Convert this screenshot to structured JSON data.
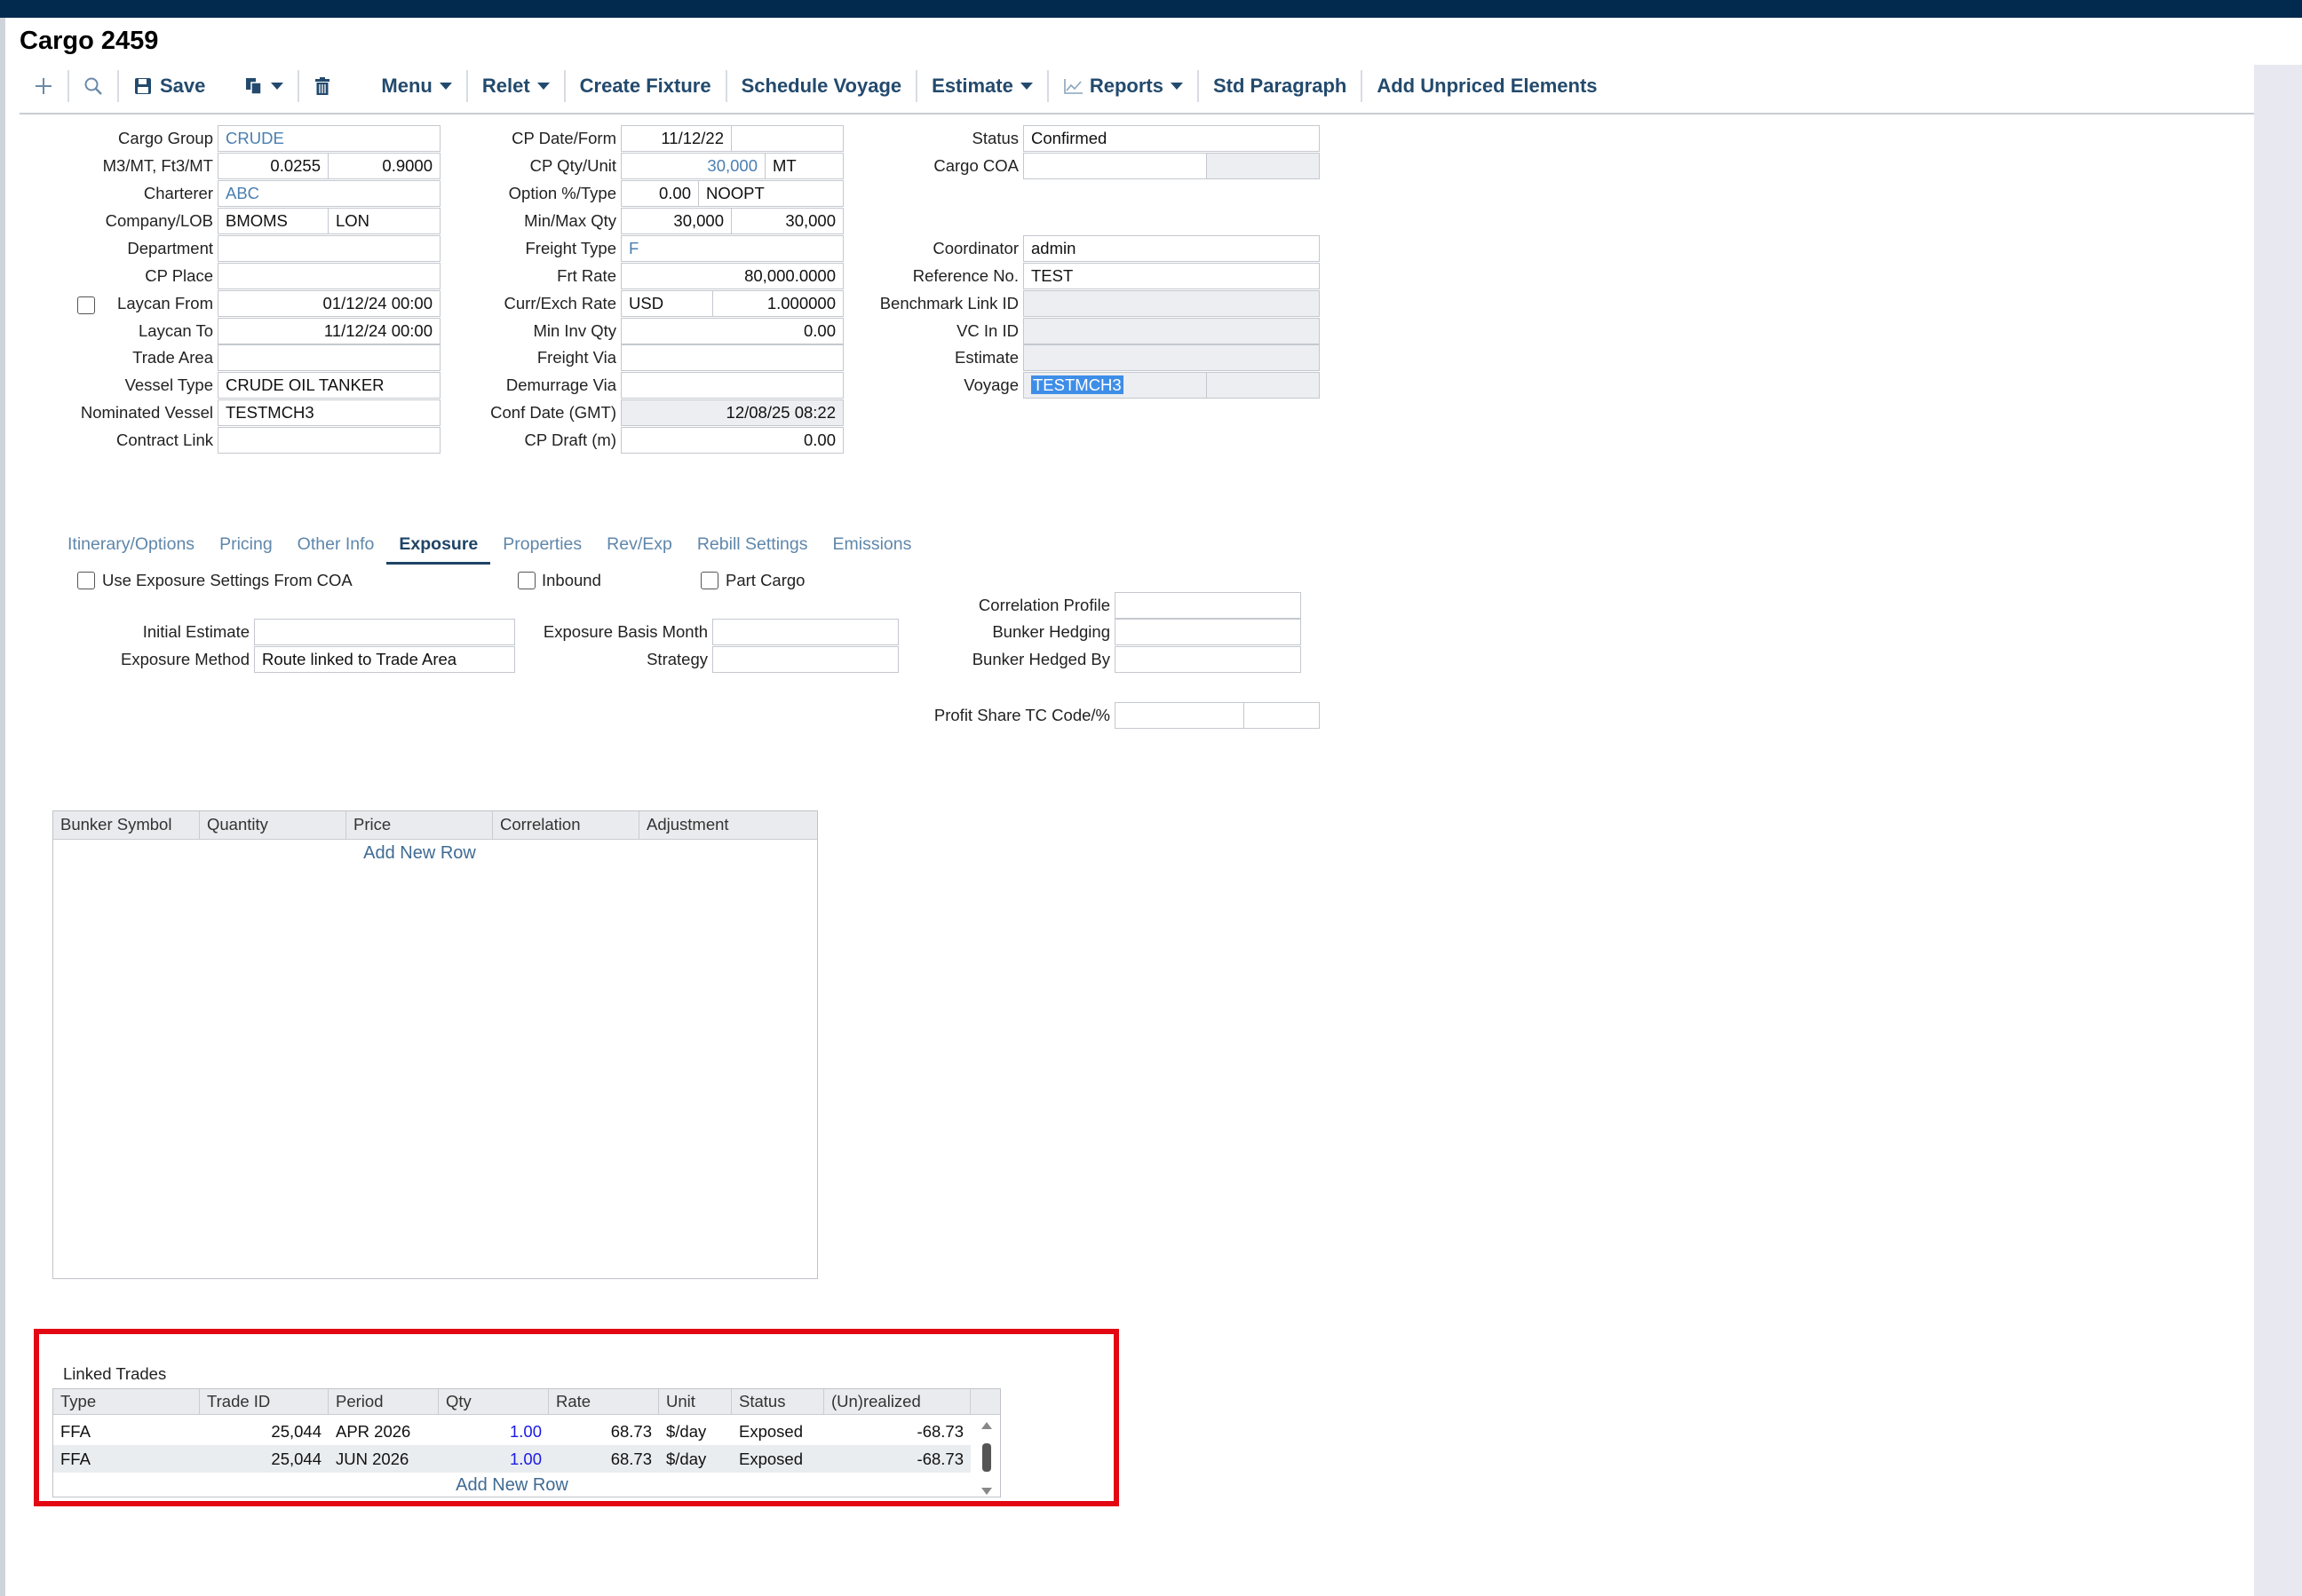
{
  "window": {
    "title": "Cargo 2459"
  },
  "toolbar": {
    "save_label": "Save",
    "menu_label": "Menu",
    "relet_label": "Relet",
    "create_fixture_label": "Create Fixture",
    "schedule_voyage_label": "Schedule Voyage",
    "estimate_label": "Estimate",
    "reports_label": "Reports",
    "std_paragraph_label": "Std Paragraph",
    "add_unpriced_label": "Add Unpriced Elements"
  },
  "form": {
    "cargo_group": {
      "label": "Cargo Group",
      "value": "CRUDE"
    },
    "m3mt": {
      "label": "M3/MT, Ft3/MT",
      "value1": "0.0255",
      "value2": "0.9000"
    },
    "charterer": {
      "label": "Charterer",
      "value": "ABC"
    },
    "company_lob": {
      "label": "Company/LOB",
      "value1": "BMOMS",
      "value2": "LON"
    },
    "department": {
      "label": "Department",
      "value": ""
    },
    "cp_place": {
      "label": "CP Place",
      "value": ""
    },
    "laycan_from": {
      "label": "Laycan From",
      "value": "01/12/24 00:00"
    },
    "laycan_to": {
      "label": "Laycan To",
      "value": "11/12/24 00:00"
    },
    "trade_area": {
      "label": "Trade Area",
      "value": ""
    },
    "vessel_type": {
      "label": "Vessel Type",
      "value": "CRUDE OIL TANKER"
    },
    "nominated_vessel": {
      "label": "Nominated Vessel",
      "value": "TESTMCH3"
    },
    "contract_link": {
      "label": "Contract Link",
      "value": ""
    },
    "cp_date_form": {
      "label": "CP Date/Form",
      "value1": "11/12/22",
      "value2": ""
    },
    "cp_qty_unit": {
      "label": "CP Qty/Unit",
      "value1": "30,000",
      "value2": "MT"
    },
    "option_type": {
      "label": "Option %/Type",
      "value1": "0.00",
      "value2": "NOOPT"
    },
    "min_max_qty": {
      "label": "Min/Max Qty",
      "value1": "30,000",
      "value2": "30,000"
    },
    "freight_type": {
      "label": "Freight Type",
      "value": "F"
    },
    "frt_rate": {
      "label": "Frt Rate",
      "value": "80,000.0000"
    },
    "curr_exch_rate": {
      "label": "Curr/Exch Rate",
      "value1": "USD",
      "value2": "1.000000"
    },
    "min_inv_qty": {
      "label": "Min Inv Qty",
      "value": "0.00"
    },
    "freight_via": {
      "label": "Freight Via",
      "value": ""
    },
    "demurrage_via": {
      "label": "Demurrage Via",
      "value": ""
    },
    "conf_date": {
      "label": "Conf Date (GMT)",
      "value": "12/08/25 08:22"
    },
    "cp_draft": {
      "label": "CP Draft (m)",
      "value": "0.00"
    },
    "status": {
      "label": "Status",
      "value": "Confirmed"
    },
    "cargo_coa": {
      "label": "Cargo COA",
      "value": ""
    },
    "coordinator": {
      "label": "Coordinator",
      "value": "admin"
    },
    "reference_no": {
      "label": "Reference No.",
      "value": "TEST"
    },
    "benchmark_link_id": {
      "label": "Benchmark Link ID",
      "value": ""
    },
    "vc_in_id": {
      "label": "VC In ID",
      "value": ""
    },
    "estimate": {
      "label": "Estimate",
      "value": ""
    },
    "voyage": {
      "label": "Voyage",
      "value": "TESTMCH3"
    }
  },
  "tabs": [
    {
      "label": "Itinerary/Options"
    },
    {
      "label": "Pricing"
    },
    {
      "label": "Other Info"
    },
    {
      "label": "Exposure"
    },
    {
      "label": "Properties"
    },
    {
      "label": "Rev/Exp"
    },
    {
      "label": "Rebill Settings"
    },
    {
      "label": "Emissions"
    }
  ],
  "exposure": {
    "use_coa_label": "Use Exposure Settings From COA",
    "inbound_label": "Inbound",
    "part_cargo_label": "Part Cargo",
    "correlation_profile": {
      "label": "Correlation Profile",
      "value": ""
    },
    "initial_estimate": {
      "label": "Initial Estimate",
      "value": ""
    },
    "exposure_basis_month": {
      "label": "Exposure Basis Month",
      "value": ""
    },
    "bunker_hedging": {
      "label": "Bunker Hedging",
      "value": ""
    },
    "exposure_method": {
      "label": "Exposure Method",
      "value": "Route linked to Trade Area"
    },
    "strategy": {
      "label": "Strategy",
      "value": ""
    },
    "bunker_hedged_by": {
      "label": "Bunker Hedged By",
      "value": ""
    },
    "profit_share": {
      "label": "Profit Share TC Code/%",
      "value1": "",
      "value2": ""
    }
  },
  "bunker_grid": {
    "columns": [
      "Bunker Symbol",
      "Quantity",
      "Price",
      "Correlation",
      "Adjustment"
    ],
    "add_row_label": "Add New Row"
  },
  "linked_trades": {
    "title": "Linked Trades",
    "columns": [
      "Type",
      "Trade ID",
      "Period",
      "Qty",
      "Rate",
      "Unit",
      "Status",
      "(Un)realized"
    ],
    "rows": [
      [
        "FFA",
        "25,044",
        "APR 2026",
        "1.00",
        "68.73",
        "$/day",
        "Exposed",
        "-68.73"
      ],
      [
        "FFA",
        "25,044",
        "JUN 2026",
        "1.00",
        "68.73",
        "$/day",
        "Exposed",
        "-68.73"
      ]
    ],
    "add_row_label": "Add New Row"
  },
  "colors": {
    "accent": "#234a6d",
    "header": "#022a4e",
    "highlight": "#e30613",
    "link": "#4a7fb1"
  }
}
